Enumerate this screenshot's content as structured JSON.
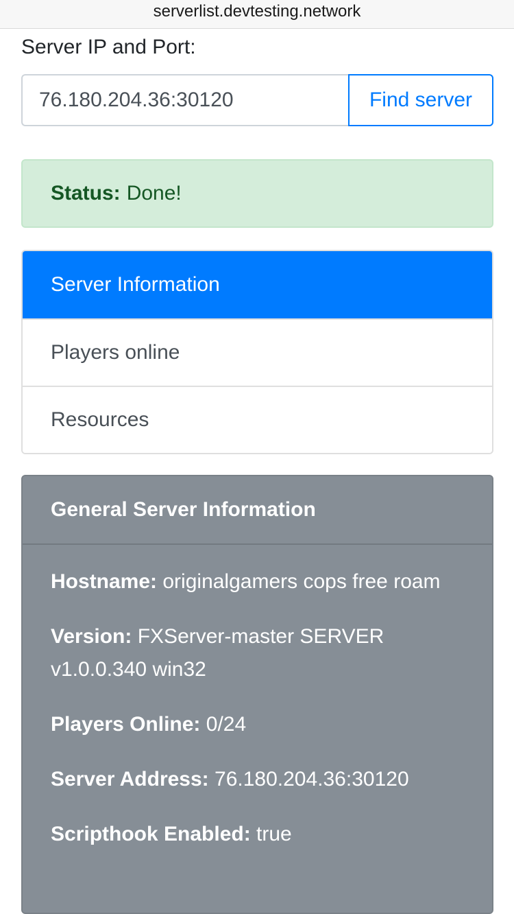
{
  "browser": {
    "url": "serverlist.devtesting.network"
  },
  "form": {
    "label": "Server IP and Port:",
    "ip_value": "76.180.204.36:30120",
    "find_button": "Find server"
  },
  "status": {
    "label": "Status:",
    "text": "Done!"
  },
  "tabs": [
    {
      "label": "Server Information",
      "active": true
    },
    {
      "label": "Players online",
      "active": false
    },
    {
      "label": "Resources",
      "active": false
    }
  ],
  "card": {
    "title": "General Server Information",
    "rows": [
      {
        "key": "Hostname:",
        "value": "originalgamers cops free roam"
      },
      {
        "key": "Version:",
        "value": "FXServer-master SERVER v1.0.0.340 win32"
      },
      {
        "key": "Players Online:",
        "value": "0/24"
      },
      {
        "key": "Server Address:",
        "value": "76.180.204.36:30120"
      },
      {
        "key": "Scripthook Enabled:",
        "value": "true"
      }
    ]
  },
  "colors": {
    "primary": "#007bff",
    "success_bg": "#d4edda",
    "success_text": "#155724",
    "card_bg": "#868e96"
  }
}
